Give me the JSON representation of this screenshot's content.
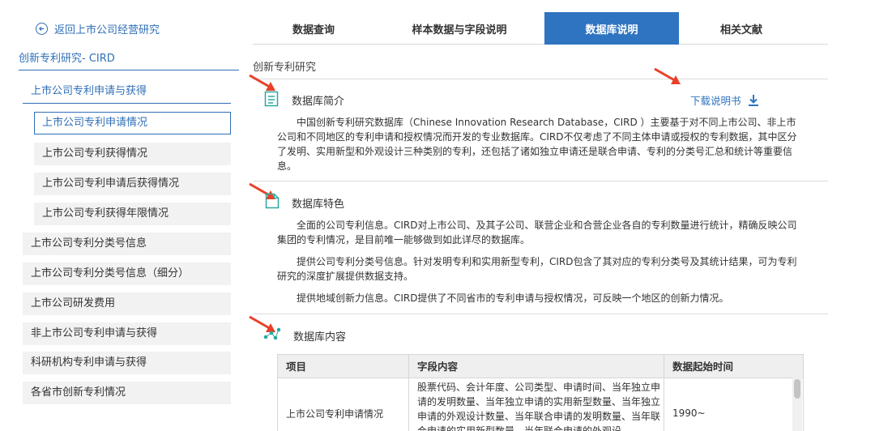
{
  "sidebar": {
    "back_label": "返回上市公司经营研究",
    "category": "创新专利研究- CIRD",
    "group_title": "上市公司专利申请与获得",
    "sub_items": [
      {
        "label": "上市公司专利申请情况"
      },
      {
        "label": "上市公司专利获得情况"
      },
      {
        "label": "上市公司专利申请后获得情况"
      },
      {
        "label": "上市公司专利获得年限情况"
      }
    ],
    "items": [
      {
        "label": "上市公司专利分类号信息"
      },
      {
        "label": "上市公司专利分类号信息（细分）"
      },
      {
        "label": "上市公司研发费用"
      },
      {
        "label": "非上市公司专利申请与获得"
      },
      {
        "label": "科研机构专利申请与获得"
      },
      {
        "label": "各省市创新专利情况"
      }
    ]
  },
  "tabs": [
    {
      "label": "数据查询"
    },
    {
      "label": "样本数据与字段说明"
    },
    {
      "label": "数据库说明"
    },
    {
      "label": "相关文献"
    }
  ],
  "main": {
    "section_label": "创新专利研究",
    "download_label": "下载说明书",
    "intro": {
      "title": "数据库简介",
      "text": "中国创新专利研究数据库（Chinese Innovation Research Database，CIRD ）主要基于对不同上市公司、非上市公司和不同地区的专利申请和授权情况而开发的专业数据库。CIRD不仅考虑了不同主体申请或授权的专利数据，其中区分了发明、实用新型和外观设计三种类别的专利，还包括了诸如独立申请还是联合申请、专利的分类号汇总和统计等重要信息。"
    },
    "features": {
      "title": "数据库特色",
      "paragraphs": [
        "全面的公司专利信息。CIRD对上市公司、及其子公司、联营企业和合营企业各自的专利数量进行统计，精确反映公司集团的专利情况，是目前唯一能够做到如此详尽的数据库。",
        "提供公司专利分类号信息。针对发明专利和实用新型专利，CIRD包含了其对应的专利分类号及其统计结果，可为专利研究的深度扩展提供数据支持。",
        "提供地域创新力信息。CIRD提供了不同省市的专利申请与授权情况，可反映一个地区的创新力情况。"
      ]
    },
    "content": {
      "title": "数据库内容",
      "headers": [
        "项目",
        "字段内容",
        "数据起始时间"
      ],
      "rows": [
        {
          "item": "上市公司专利申请情况",
          "fields": "股票代码、会计年度、公司类型、申请时间、当年独立申请的发明数量、当年独立申请的实用新型数量、当年独立申请的外观设计数量、当年联合申请的发明数量、当年联合申请的实用新型数量、当年联合申请的外观设",
          "start": "1990~"
        }
      ]
    }
  },
  "colors": {
    "accent": "#2f74c0",
    "arrow": "#e8402a",
    "icon": "#2aa8a0"
  }
}
